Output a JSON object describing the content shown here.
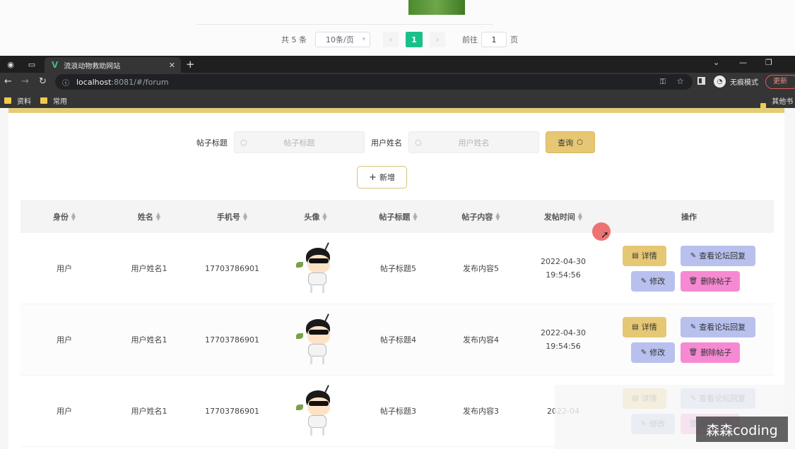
{
  "top_pager": {
    "total": "共 5 条",
    "page_size": "10条/页",
    "prev": "‹",
    "current_page": "1",
    "next": "›",
    "goto_label": "前往",
    "goto_value": "1",
    "page_suffix": "页"
  },
  "browser": {
    "tab_title": "流浪动物救助网站",
    "url_host": "localhost",
    "url_path": ":8081/#/forum",
    "incognito_label": "无痕模式",
    "update_label": "更新",
    "bookmarks": [
      "资料",
      "常用"
    ],
    "other_bookmarks": "其他书签"
  },
  "search": {
    "title_label": "帖子标题",
    "title_placeholder": "帖子标题",
    "user_label": "用户姓名",
    "user_placeholder": "用户姓名",
    "query_button": "查询"
  },
  "add_button": "新增",
  "table": {
    "headers": [
      "身份",
      "姓名",
      "手机号",
      "头像",
      "帖子标题",
      "帖子内容",
      "发帖时间",
      "操作"
    ],
    "rows": [
      {
        "role": "用户",
        "name": "用户姓名1",
        "phone": "17703786901",
        "title": "帖子标题5",
        "content": "发布内容5",
        "time": "2022-04-30 19:54:56"
      },
      {
        "role": "用户",
        "name": "用户姓名1",
        "phone": "17703786901",
        "title": "帖子标题4",
        "content": "发布内容4",
        "time": "2022-04-30 19:54:56"
      },
      {
        "role": "用户",
        "name": "用户姓名1",
        "phone": "17703786901",
        "title": "帖子标题3",
        "content": "发布内容3",
        "time": "2022-04"
      }
    ],
    "actions": {
      "detail": "详情",
      "view_replies": "查看论坛回复",
      "edit": "修改",
      "delete": "删除帖子"
    }
  },
  "watermark": "森森coding",
  "colors": {
    "accent_yellow": "#e6c773",
    "accent_lavender": "#b8c0ee",
    "accent_pink": "#f58ad2",
    "pager_active": "#19c08a"
  }
}
